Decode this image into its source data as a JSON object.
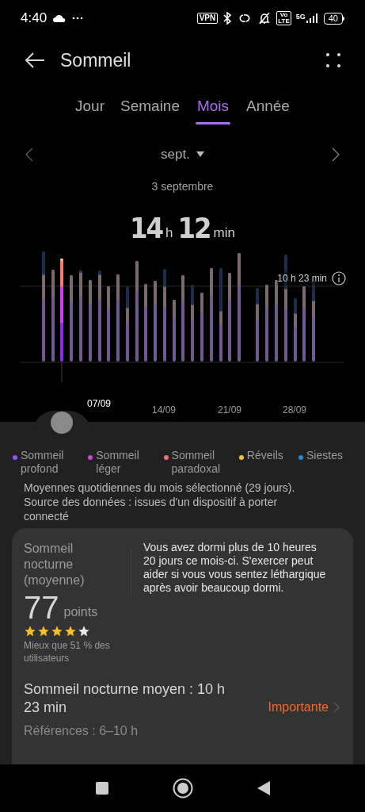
{
  "status_bar": {
    "time": "4:40",
    "vpn": "VPN",
    "volte": [
      "Vo",
      "LTE"
    ],
    "network": "5G",
    "battery": "40"
  },
  "header": {
    "title": "Sommeil"
  },
  "tabs": [
    {
      "label": "Jour",
      "selected": false
    },
    {
      "label": "Semaine",
      "selected": false
    },
    {
      "label": "Mois",
      "selected": true
    },
    {
      "label": "Année",
      "selected": false
    }
  ],
  "period": {
    "label": "sept."
  },
  "selected_date": "3 septembre",
  "total": {
    "hours": "14",
    "hours_unit": "h",
    "minutes": "12",
    "minutes_unit": "min"
  },
  "chart": {
    "reference_label": "10 h 23 min",
    "x_labels": [
      {
        "label": "07/09",
        "selected": true
      },
      {
        "label": "14/09",
        "selected": false
      },
      {
        "label": "21/09",
        "selected": false
      },
      {
        "label": "28/09",
        "selected": false
      }
    ]
  },
  "legend": [
    {
      "label": "Sommeil profond",
      "color": "#9b4dff"
    },
    {
      "label": "Sommeil léger",
      "color": "#d23fe6"
    },
    {
      "label": "Sommeil paradoxal",
      "color": "#f07272"
    },
    {
      "label": "Réveils",
      "color": "#f5c22e"
    },
    {
      "label": "Siestes",
      "color": "#1e88e5"
    }
  ],
  "note": "Moyennes quotidiennes du mois sélectionné (29 jours). Source des données : issues d'un dispositif à porter connecté",
  "card": {
    "title": "Sommeil nocturne (moyenne)",
    "score": "77",
    "score_unit": "points",
    "stars": 4,
    "comparison": "Mieux que 51 % des utilisateurs",
    "advice": "Vous avez dormi plus de 10 heures 20 jours ce mois-ci. S'exercer peut aider si vous vous sentez léthargique après avoir beaucoup dormi.",
    "average": "Sommeil nocturne moyen : 10 h 23 min",
    "status": "Importante",
    "references": "Références : 6–10 h"
  }
}
